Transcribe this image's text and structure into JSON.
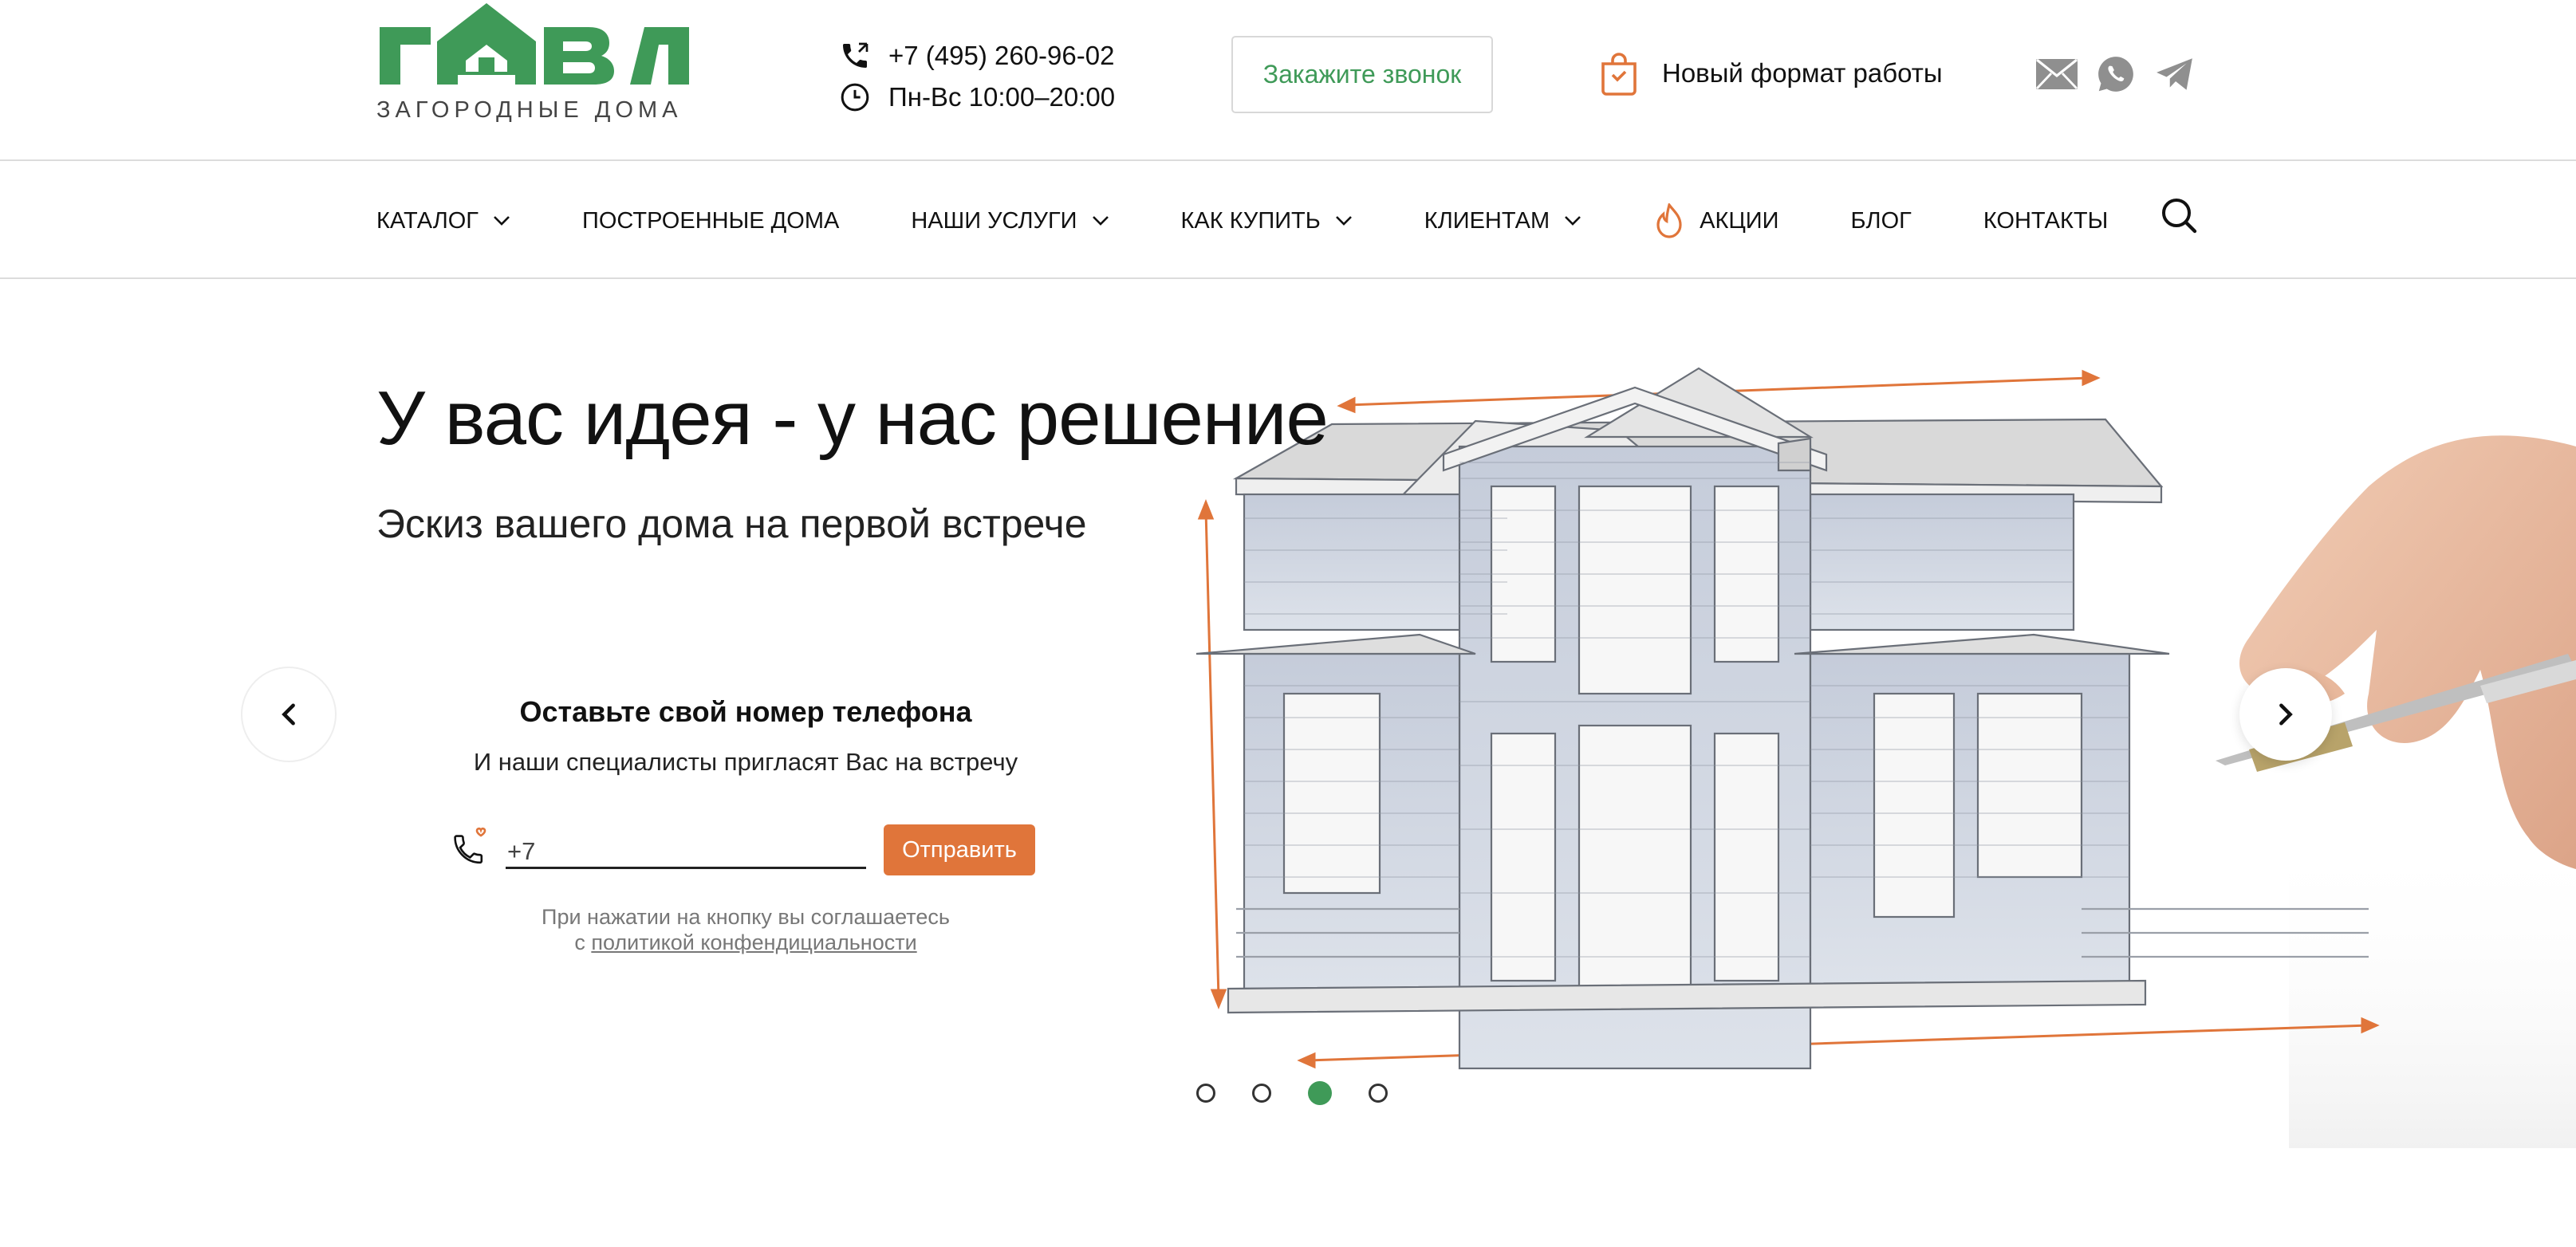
{
  "brand": {
    "logo_text": "ГАВЛ",
    "tagline": "ЗАГОРОДНЫЕ ДОМА",
    "green": "#3f9a58",
    "orange": "#e0753a"
  },
  "header": {
    "phone": "+7 (495) 260-96-02",
    "hours": "Пн-Вс 10:00–20:00",
    "callback_label": "Закажите звонок",
    "new_format_label": "Новый формат работы",
    "socials": [
      "mail-icon",
      "whatsapp-icon",
      "telegram-icon"
    ]
  },
  "nav": {
    "items": [
      {
        "label": "КАТАЛОГ",
        "dropdown": true
      },
      {
        "label": "ПОСТРОЕННЫЕ ДОМА",
        "dropdown": false
      },
      {
        "label": "НАШИ УСЛУГИ",
        "dropdown": true
      },
      {
        "label": "КАК КУПИТЬ",
        "dropdown": true
      },
      {
        "label": "КЛИЕНТАМ",
        "dropdown": true
      },
      {
        "label": "АКЦИИ",
        "dropdown": false,
        "icon": "fire-icon"
      },
      {
        "label": "БЛОГ",
        "dropdown": false
      },
      {
        "label": "КОНТАКТЫ",
        "dropdown": false
      }
    ]
  },
  "hero": {
    "title": "У вас идея - у нас решение",
    "subtitle": "Эскиз вашего дома на первой встрече",
    "form": {
      "title": "Оставьте свой номер телефона",
      "subtitle": "И наши специалисты пригласят Вас на встречу",
      "phone_value": "+7",
      "submit_label": "Отправить",
      "consent_prefix": "При нажатии на кнопку вы соглашаетесь",
      "consent_conj": "с",
      "consent_link": "политикой конфендициальности"
    },
    "slider": {
      "total": 4,
      "active": 3
    }
  }
}
